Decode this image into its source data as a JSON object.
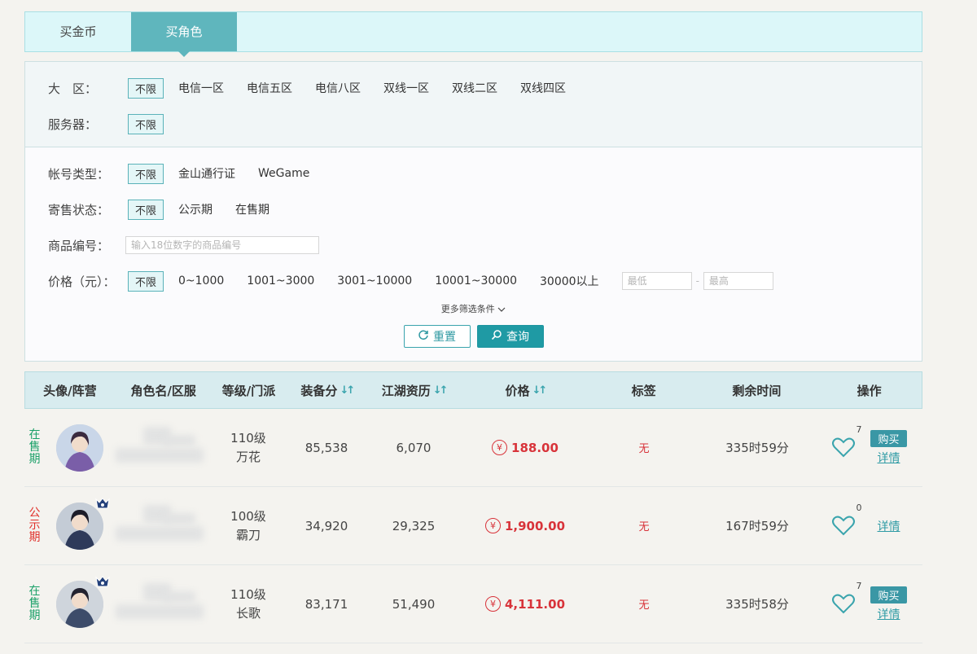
{
  "tabs": [
    {
      "label": "买金币",
      "active": false
    },
    {
      "label": "买角色",
      "active": true
    }
  ],
  "filters": {
    "region": {
      "label": "大　区：",
      "options": [
        "不限",
        "电信一区",
        "电信五区",
        "电信八区",
        "双线一区",
        "双线二区",
        "双线四区"
      ],
      "selected": "不限"
    },
    "server": {
      "label": "服务器：",
      "options": [
        "不限"
      ],
      "selected": "不限"
    },
    "account_type": {
      "label": "帐号类型：",
      "options": [
        "不限",
        "金山通行证",
        "WeGame"
      ],
      "selected": "不限"
    },
    "sale_status": {
      "label": "寄售状态：",
      "options": [
        "不限",
        "公示期",
        "在售期"
      ],
      "selected": "不限"
    },
    "item_id": {
      "label": "商品编号：",
      "placeholder": "输入18位数字的商品编号"
    },
    "price": {
      "label": "价格（元）：",
      "options": [
        "不限",
        "0~1000",
        "1001~3000",
        "3001~10000",
        "10001~30000",
        "30000以上"
      ],
      "selected": "不限",
      "min_placeholder": "最低",
      "max_placeholder": "最高",
      "separator": "-"
    },
    "more": "更多筛选条件",
    "reset_label": "重置",
    "query_label": "查询"
  },
  "table": {
    "headers": [
      "头像/阵营",
      "角色名/区服",
      "等级/门派",
      "装备分",
      "江湖资历",
      "价格",
      "标签",
      "剩余时间",
      "操作"
    ],
    "sortable": [
      "装备分",
      "江湖资历",
      "价格"
    ],
    "rows": [
      {
        "status": "在售期",
        "status_color": "#1aa068",
        "camp_badge": false,
        "level": "110级",
        "school": "万花",
        "gear": "85,538",
        "rank": "6,070",
        "price": "188.00",
        "tag": "无",
        "remaining": "335时59分",
        "likes": "7",
        "buy": "购买",
        "detail": "详情",
        "avatar": "avatar-1"
      },
      {
        "status": "公示期",
        "status_color": "#e0302a",
        "camp_badge": true,
        "level": "100级",
        "school": "霸刀",
        "gear": "34,920",
        "rank": "29,325",
        "price": "1,900.00",
        "tag": "无",
        "remaining": "167时59分",
        "likes": "0",
        "buy": "",
        "detail": "详情",
        "avatar": "avatar-2"
      },
      {
        "status": "在售期",
        "status_color": "#1aa068",
        "camp_badge": true,
        "level": "110级",
        "school": "长歌",
        "gear": "83,171",
        "rank": "51,490",
        "price": "4,111.00",
        "tag": "无",
        "remaining": "335时58分",
        "likes": "7",
        "buy": "购买",
        "detail": "详情",
        "avatar": "avatar-3"
      }
    ],
    "currency_symbol": "¥"
  }
}
